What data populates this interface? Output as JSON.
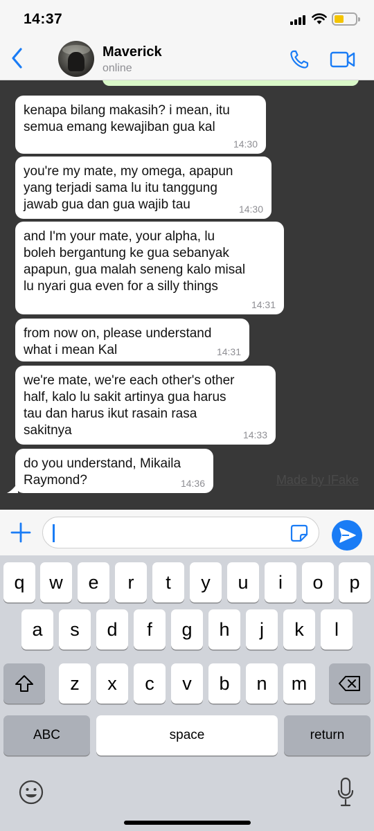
{
  "status_bar": {
    "time": "14:37",
    "battery_color": "#f4c400"
  },
  "header": {
    "back_icon": "chevron-left-icon",
    "contact_name": "Maverick",
    "contact_status": "online",
    "call_icon": "phone-icon",
    "video_icon": "video-camera-icon",
    "accent_color": "#1a7cf5"
  },
  "chat": {
    "background": "#383838",
    "messages": [
      {
        "text": "kenapa bilang makasih? i mean, itu\nsemua emang kewajiban gua kal",
        "time": "14:30"
      },
      {
        "text": "you're my mate, my omega, apapun\nyang terjadi sama lu itu tanggung\njawab gua dan gua wajib tau",
        "time": "14:30"
      },
      {
        "text": "and I'm your mate, your alpha, lu\nboleh bergantung ke gua sebanyak\napapun, gua malah seneng kalo misal\nlu nyari gua even for a silly things",
        "time": "14:31"
      },
      {
        "text": "from now on, please understand\nwhat i mean Kal",
        "time": "14:31"
      },
      {
        "text": "we're mate, we're each other's other\nhalf, kalo lu sakit artinya gua harus\ntau dan harus ikut rasain rasa\nsakitnya",
        "time": "14:33"
      },
      {
        "text": "do you understand, Mikaila\nRaymond?",
        "time": "14:36"
      }
    ],
    "watermark": "Made by IFake"
  },
  "input": {
    "value": "",
    "plus_icon": "plus-icon",
    "sticker_icon": "sticker-icon",
    "send_icon": "send-icon"
  },
  "keyboard": {
    "row1": [
      "q",
      "w",
      "e",
      "r",
      "t",
      "y",
      "u",
      "i",
      "o",
      "p"
    ],
    "row2": [
      "a",
      "s",
      "d",
      "f",
      "g",
      "h",
      "j",
      "k",
      "l"
    ],
    "row3": [
      "z",
      "x",
      "c",
      "v",
      "b",
      "n",
      "m"
    ],
    "abc_label": "ABC",
    "space_label": "space",
    "return_label": "return",
    "shift_icon": "shift-icon",
    "delete_icon": "backspace-icon",
    "emoji_icon": "emoji-icon",
    "mic_icon": "microphone-icon"
  }
}
